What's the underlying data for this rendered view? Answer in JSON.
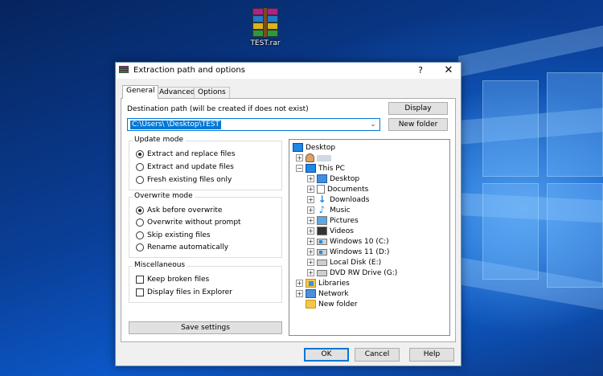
{
  "desktop": {
    "icon_label": "TEST.rar"
  },
  "dialog": {
    "title": "Extraction path and options",
    "help_glyph": "?",
    "close_glyph": "✕",
    "tabs": [
      {
        "label": "General",
        "active": true
      },
      {
        "label": "Advanced",
        "active": false
      },
      {
        "label": "Options",
        "active": false
      }
    ],
    "destination": {
      "label": "Destination path (will be created if does not exist)",
      "value": "C:\\Users\\                    \\Desktop\\TEST"
    },
    "buttons": {
      "display": "Display",
      "new_folder": "New folder",
      "save_settings": "Save settings",
      "ok": "OK",
      "cancel": "Cancel",
      "help": "Help"
    },
    "update_mode": {
      "title": "Update mode",
      "options": [
        {
          "label": "Extract and replace files",
          "selected": true
        },
        {
          "label": "Extract and update files",
          "selected": false
        },
        {
          "label": "Fresh existing files only",
          "selected": false
        }
      ]
    },
    "overwrite_mode": {
      "title": "Overwrite mode",
      "options": [
        {
          "label": "Ask before overwrite",
          "selected": true
        },
        {
          "label": "Overwrite without prompt",
          "selected": false
        },
        {
          "label": "Skip existing files",
          "selected": false
        },
        {
          "label": "Rename automatically",
          "selected": false
        }
      ]
    },
    "miscellaneous": {
      "title": "Miscellaneous",
      "options": [
        {
          "label": "Keep broken files",
          "checked": false
        },
        {
          "label": "Display files in Explorer",
          "checked": false
        }
      ]
    },
    "tree": {
      "nodes": [
        {
          "label": "Desktop",
          "icon": "monitor-icon"
        },
        {
          "label": "",
          "icon": "user-icon"
        },
        {
          "label": "This PC",
          "icon": "monitor-icon"
        },
        {
          "label": "Desktop",
          "icon": "desktop-folder-icon"
        },
        {
          "label": "Documents",
          "icon": "documents-icon"
        },
        {
          "label": "Downloads",
          "icon": "downloads-icon"
        },
        {
          "label": "Music",
          "icon": "music-icon"
        },
        {
          "label": "Pictures",
          "icon": "pictures-icon"
        },
        {
          "label": "Videos",
          "icon": "videos-icon"
        },
        {
          "label": "Windows 10 (C:)",
          "icon": "windows-drive-icon"
        },
        {
          "label": "Windows 11 (D:)",
          "icon": "windows-drive-icon"
        },
        {
          "label": "Local Disk (E:)",
          "icon": "drive-icon"
        },
        {
          "label": "DVD RW Drive (G:)",
          "icon": "dvd-drive-icon"
        },
        {
          "label": "Libraries",
          "icon": "libraries-icon"
        },
        {
          "label": "Network",
          "icon": "network-icon"
        },
        {
          "label": "New folder",
          "icon": "folder-icon"
        }
      ]
    }
  }
}
